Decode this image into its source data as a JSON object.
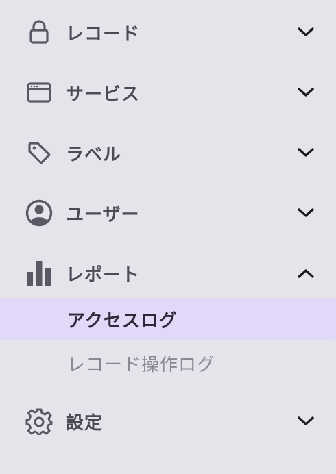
{
  "menu": {
    "items": [
      {
        "label": "レコード",
        "icon": "lock-icon",
        "expanded": false
      },
      {
        "label": "サービス",
        "icon": "browser-window-icon",
        "expanded": false
      },
      {
        "label": "ラベル",
        "icon": "tag-icon",
        "expanded": false
      },
      {
        "label": "ユーザー",
        "icon": "user-circle-icon",
        "expanded": false
      },
      {
        "label": "レポート",
        "icon": "bar-chart-icon",
        "expanded": true,
        "children": [
          {
            "label": "アクセスログ",
            "active": true
          },
          {
            "label": "レコード操作ログ",
            "active": false
          }
        ]
      },
      {
        "label": "設定",
        "icon": "gear-icon",
        "expanded": false
      }
    ]
  },
  "colors": {
    "background": "#e5e4eb",
    "active_background": "#e2d8f8",
    "icon": "#5b5866",
    "label": "#4d4a58",
    "active_label": "#2e2a3a",
    "inactive_label": "#8a8795",
    "chevron": "#1a1a1a"
  }
}
